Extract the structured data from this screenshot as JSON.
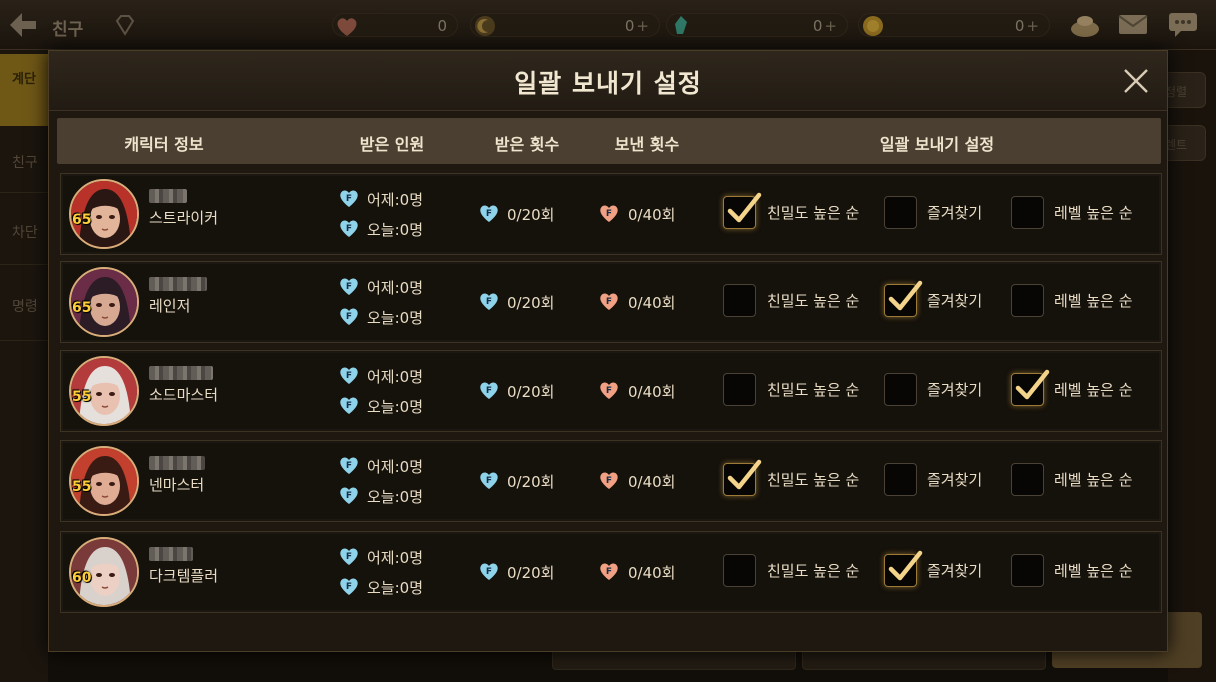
{
  "topbar": {
    "title": "친구",
    "resources": [
      {
        "name": "heart",
        "value": "0",
        "plus": ""
      },
      {
        "name": "gold",
        "value": "0",
        "plus": "+"
      },
      {
        "name": "gem",
        "value": "0",
        "plus": "+"
      },
      {
        "name": "coin",
        "value": "0",
        "plus": "+"
      }
    ]
  },
  "background": {
    "left_tab": "계단",
    "left_items": [
      "친구",
      "차단",
      "명령"
    ],
    "right_buttons": [
      "정렬",
      "렌트"
    ]
  },
  "dialog": {
    "title": "일괄 보내기 설정",
    "columns": {
      "char_info": "캐릭터 정보",
      "received_people": "받은 인원",
      "received_count": "받은 횟수",
      "sent_count": "보낸 횟수",
      "bulk_setting": "일괄 보내기 설정"
    },
    "option_labels": [
      "친밀도 높은 순",
      "즐겨찾기",
      "레벨 높은 순"
    ],
    "rows": [
      {
        "level": "65",
        "class": "스트라이커",
        "yesterday": "어제:0명",
        "today": "오늘:0명",
        "received": "0/20회",
        "sent": "0/40회",
        "selected": 0
      },
      {
        "level": "65",
        "class": "레인저",
        "yesterday": "어제:0명",
        "today": "오늘:0명",
        "received": "0/20회",
        "sent": "0/40회",
        "selected": 1
      },
      {
        "level": "55",
        "class": "소드마스터",
        "yesterday": "어제:0명",
        "today": "오늘:0명",
        "received": "0/20회",
        "sent": "0/40회",
        "selected": 2
      },
      {
        "level": "55",
        "class": "넨마스터",
        "yesterday": "어제:0명",
        "today": "오늘:0명",
        "received": "0/20회",
        "sent": "0/40회",
        "selected": 0
      },
      {
        "level": "60",
        "class": "다크템플러",
        "yesterday": "어제:0명",
        "today": "오늘:0명",
        "received": "0/20회",
        "sent": "0/40회",
        "selected": 1
      }
    ]
  },
  "colors": {
    "heart_received": "#8fd3ea",
    "heart_sent": "#f2a083",
    "check_mark": "#f3d48a",
    "level_text": "#ffcf3a"
  }
}
